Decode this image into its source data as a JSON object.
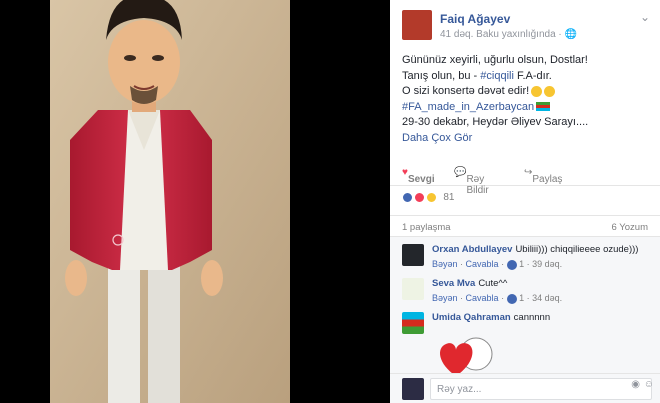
{
  "post": {
    "author": "Faiq Ağayev",
    "meta": "41 dəq. Baku yaxınlığında · 🌐",
    "lines": [
      "Gününüz xeyirli, uğurlu olsun, Dostlar!",
      "Tanış olun, bu - ",
      "#ciqqili",
      " F.A-dır.",
      "O sizi konsertə dəvət edir!",
      "#FA_made_in_Azerbaycan",
      "29-30 dekabr, Heydər Əliyev Sarayı....",
      "Daha Çox Gör"
    ]
  },
  "actions": {
    "like": "Sevgi",
    "comment": "Rəy Bildir",
    "share": "Paylaş"
  },
  "reactions": {
    "count": "81"
  },
  "stats": {
    "shares": "1 paylaşma",
    "views": "6 Yozum"
  },
  "comments": [
    {
      "author": "Orxan Abdullayev",
      "text": "Ubiliii))) chiqqilieeee ozude)))",
      "like": "Bəyən",
      "reply": "Cavabla",
      "likes": "1",
      "time": "39 dəq."
    },
    {
      "author": "Seva Mva",
      "text": "Cute^^",
      "like": "Bəyən",
      "reply": "Cavabla",
      "likes": "1",
      "time": "34 dəq."
    },
    {
      "author": "Umida Qahraman",
      "text": "cannnnn"
    }
  ],
  "reply": {
    "placeholder": "Rəy yaz..."
  },
  "colors": {
    "link": "#365899",
    "love": "#f33e58",
    "jacket": "#c7263b"
  }
}
